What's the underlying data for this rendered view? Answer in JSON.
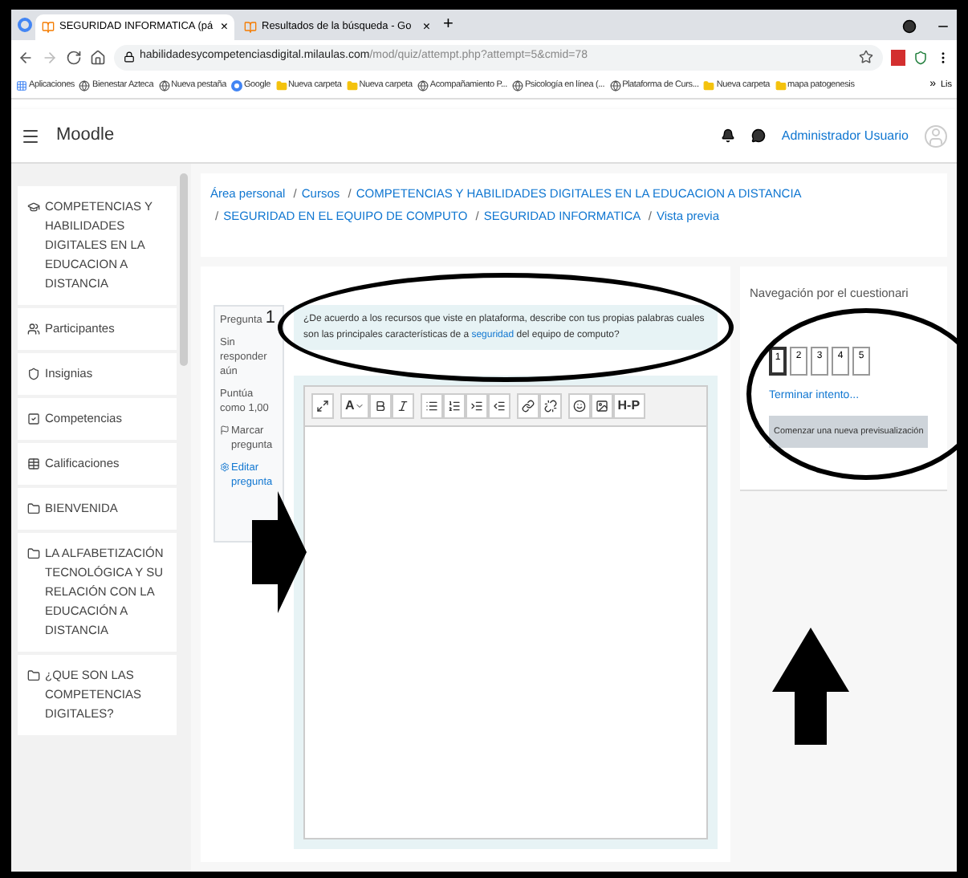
{
  "browser": {
    "tabs": [
      {
        "title": "SEGURIDAD INFORMATICA (pá",
        "selected": true
      },
      {
        "title": "Resultados de la búsqueda - Go",
        "selected": false
      }
    ],
    "tab_close": "×",
    "new_tab": "+",
    "url_host": "habilidadesycompetenciasdigital.milaulas.com",
    "url_path": "/mod/quiz/attempt.php?attempt=5&cmid=78",
    "bookmarks": [
      {
        "kind": "apps",
        "label": "Aplicaciones"
      },
      {
        "kind": "site",
        "label": "Bienestar Azteca"
      },
      {
        "kind": "site",
        "label": "Nueva pestaña"
      },
      {
        "kind": "google",
        "label": "Google"
      },
      {
        "kind": "folder",
        "label": "Nueva carpeta"
      },
      {
        "kind": "folder",
        "label": "Nueva carpeta"
      },
      {
        "kind": "site",
        "label": "Acompañamiento P..."
      },
      {
        "kind": "site",
        "label": "Psicología en línea (..."
      },
      {
        "kind": "site",
        "label": "Plataforma de Curs..."
      },
      {
        "kind": "folder",
        "label": "Nueva carpeta"
      },
      {
        "kind": "folder",
        "label": "mapa patogenesis"
      }
    ],
    "bookmarks_overflow": "»",
    "reading_list": "Lis"
  },
  "header": {
    "brand": "Moodle",
    "user": "Administrador Usuario"
  },
  "sidebar": {
    "items": [
      {
        "kind": "course",
        "label": "COMPETENCIAS Y HABILIDADES DIGITALES EN LA EDUCACION A DISTANCIA"
      },
      {
        "kind": "participants",
        "label": "Participantes"
      },
      {
        "kind": "badges",
        "label": "Insignias"
      },
      {
        "kind": "competencies",
        "label": "Competencias"
      },
      {
        "kind": "grades",
        "label": "Calificaciones"
      },
      {
        "kind": "section",
        "label": "BIENVENIDA"
      },
      {
        "kind": "section",
        "label": "LA ALFABETIZACIÓN TECNOLÓGICA Y SU RELACIÓN CON LA EDUCACIÓN A DISTANCIA"
      },
      {
        "kind": "section",
        "label": "¿QUE SON LAS COMPETENCIAS DIGITALES?"
      }
    ]
  },
  "breadcrumb": [
    "Área personal",
    "Cursos",
    "COMPETENCIAS Y HABILIDADES DIGITALES EN LA EDUCACION A DISTANCIA",
    "SEGURIDAD EN EL EQUIPO DE COMPUTO",
    "SEGURIDAD INFORMATICA",
    "Vista previa"
  ],
  "breadcrumb_separator": "/",
  "question": {
    "label": "Pregunta",
    "number": "1",
    "status": "Sin responder aún",
    "mark": "Puntúa como 1,00",
    "flag": "Marcar pregunta",
    "edit": "Editar pregunta",
    "text_before": "¿De acuerdo a los  recursos que viste en plataforma, describe con tus  propias  palabras cuales son las principales  características de a ",
    "link": "seguridad",
    "text_after": " del equipo de  computo?"
  },
  "editor": {
    "toolbar": [
      [
        {
          "kind": "expand"
        }
      ],
      [
        {
          "kind": "font",
          "label": "A"
        },
        {
          "kind": "bold"
        },
        {
          "kind": "italic"
        }
      ],
      [
        {
          "kind": "bullets"
        },
        {
          "kind": "numbers"
        },
        {
          "kind": "indent"
        },
        {
          "kind": "outdent"
        }
      ],
      [
        {
          "kind": "link"
        },
        {
          "kind": "unlink"
        }
      ],
      [
        {
          "kind": "emoji"
        },
        {
          "kind": "image"
        },
        {
          "kind": "h5p",
          "label": "H-P"
        }
      ]
    ]
  },
  "navigation": {
    "title": "Navegación por el cuestionari",
    "questions": [
      {
        "label": "1",
        "selected": true
      },
      {
        "label": "2",
        "selected": false
      },
      {
        "label": "3",
        "selected": false
      },
      {
        "label": "4",
        "selected": false
      },
      {
        "label": "5",
        "selected": false
      }
    ],
    "finish": "Terminar intento...",
    "restart": "Comenzar una nueva previsualización"
  }
}
